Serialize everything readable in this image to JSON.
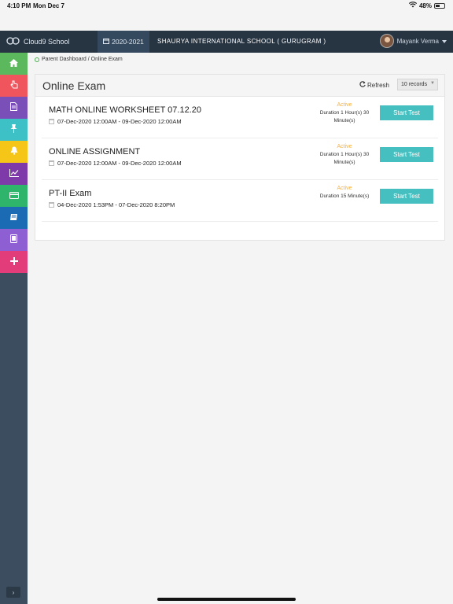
{
  "status_bar": {
    "time": "4:10 PM",
    "date": "Mon Dec 7",
    "battery": "48%"
  },
  "topnav": {
    "app_name": "Cloud9 School",
    "session_year": "2020-2021",
    "school_name": "SHAURYA INTERNATIONAL SCHOOL ( GURUGRAM )",
    "user_name": "Mayank Verma"
  },
  "sidebar": {
    "items": [
      {
        "icon": "home-icon",
        "color": "#5cb85c"
      },
      {
        "icon": "hand-pointer-icon",
        "color": "#f0545c"
      },
      {
        "icon": "document-icon",
        "color": "#7a4fb8"
      },
      {
        "icon": "pin-icon",
        "color": "#3ec1c6"
      },
      {
        "icon": "bell-icon",
        "color": "#f5c518"
      },
      {
        "icon": "chart-line-icon",
        "color": "#7d3aa8"
      },
      {
        "icon": "credit-card-icon",
        "color": "#2fb56b"
      },
      {
        "icon": "book-icon",
        "color": "#1a6bb3"
      },
      {
        "icon": "tablet-icon",
        "color": "#8e5fd3"
      },
      {
        "icon": "plus-icon",
        "color": "#e23c7a"
      }
    ],
    "toggle": "›"
  },
  "breadcrumb": {
    "text": "Parent Dashboard / Online Exam"
  },
  "panel": {
    "title": "Online Exam",
    "refresh_label": "Refresh",
    "records_label": "10 records",
    "start_label": "Start Test",
    "exams": [
      {
        "title": "MATH ONLINE WORKSHEET 07.12.20",
        "dates": "07-Dec-2020 12:00AM - 09-Dec-2020 12:00AM",
        "status": "Active",
        "duration_line1": "Duration 1 Hour(s) 30",
        "duration_line2": "Minute(s)"
      },
      {
        "title": "ONLINE ASSIGNMENT",
        "dates": "07-Dec-2020 12:00AM - 09-Dec-2020 12:00AM",
        "status": "Active",
        "duration_line1": "Duration 1 Hour(s) 30",
        "duration_line2": "Minute(s)"
      },
      {
        "title": "PT-II Exam",
        "dates": "04-Dec-2020 1:53PM - 07-Dec-2020 8:20PM",
        "status": "Active",
        "duration_line1": "Duration 15 Minute(s)",
        "duration_line2": ""
      }
    ]
  }
}
